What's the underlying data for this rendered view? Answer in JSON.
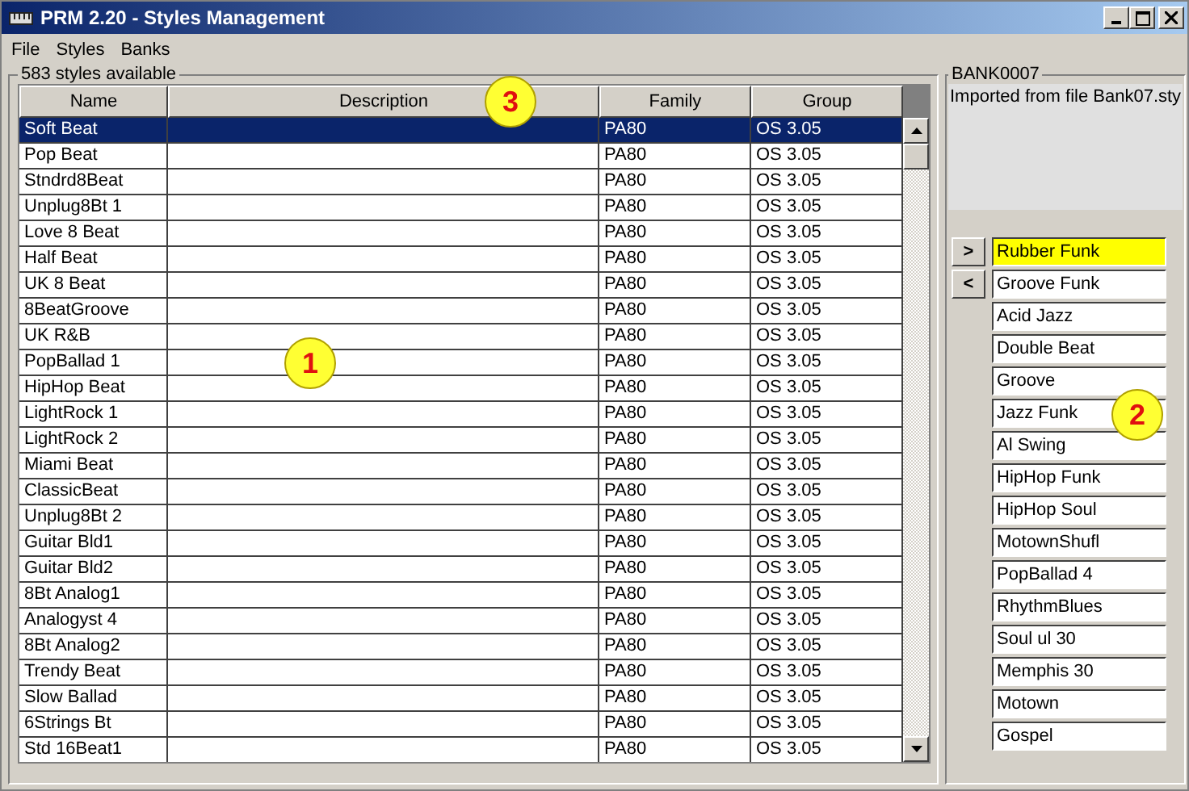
{
  "window": {
    "title": "PRM 2.20 - Styles Management"
  },
  "menu": [
    "File",
    "Styles",
    "Banks"
  ],
  "styles_panel": {
    "title": "583 styles available",
    "columns": [
      "Name",
      "Description",
      "Family",
      "Group"
    ],
    "rows": [
      {
        "name": "Soft Beat",
        "family": "PA80",
        "group": "OS 3.05",
        "selected": true
      },
      {
        "name": "Pop Beat",
        "family": "PA80",
        "group": "OS 3.05",
        "selected": false
      },
      {
        "name": "Stndrd8Beat",
        "family": "PA80",
        "group": "OS 3.05",
        "selected": false
      },
      {
        "name": "Unplug8Bt 1",
        "family": "PA80",
        "group": "OS 3.05",
        "selected": false
      },
      {
        "name": "Love 8 Beat",
        "family": "PA80",
        "group": "OS 3.05",
        "selected": false
      },
      {
        "name": "Half Beat",
        "family": "PA80",
        "group": "OS 3.05",
        "selected": false
      },
      {
        "name": "UK 8 Beat",
        "family": "PA80",
        "group": "OS 3.05",
        "selected": false
      },
      {
        "name": "8BeatGroove",
        "family": "PA80",
        "group": "OS 3.05",
        "selected": false
      },
      {
        "name": "UK R&B",
        "family": "PA80",
        "group": "OS 3.05",
        "selected": false
      },
      {
        "name": "PopBallad 1",
        "family": "PA80",
        "group": "OS 3.05",
        "selected": false
      },
      {
        "name": "HipHop Beat",
        "family": "PA80",
        "group": "OS 3.05",
        "selected": false
      },
      {
        "name": "LightRock 1",
        "family": "PA80",
        "group": "OS 3.05",
        "selected": false
      },
      {
        "name": "LightRock 2",
        "family": "PA80",
        "group": "OS 3.05",
        "selected": false
      },
      {
        "name": "Miami Beat",
        "family": "PA80",
        "group": "OS 3.05",
        "selected": false
      },
      {
        "name": "ClassicBeat",
        "family": "PA80",
        "group": "OS 3.05",
        "selected": false
      },
      {
        "name": "Unplug8Bt 2",
        "family": "PA80",
        "group": "OS 3.05",
        "selected": false
      },
      {
        "name": "Guitar Bld1",
        "family": "PA80",
        "group": "OS 3.05",
        "selected": false
      },
      {
        "name": "Guitar Bld2",
        "family": "PA80",
        "group": "OS 3.05",
        "selected": false
      },
      {
        "name": "8Bt Analog1",
        "family": "PA80",
        "group": "OS 3.05",
        "selected": false
      },
      {
        "name": "Analogyst 4",
        "family": "PA80",
        "group": "OS 3.05",
        "selected": false
      },
      {
        "name": "8Bt Analog2",
        "family": "PA80",
        "group": "OS 3.05",
        "selected": false
      },
      {
        "name": "Trendy Beat",
        "family": "PA80",
        "group": "OS 3.05",
        "selected": false
      },
      {
        "name": "Slow Ballad",
        "family": "PA80",
        "group": "OS 3.05",
        "selected": false
      },
      {
        "name": "6Strings Bt",
        "family": "PA80",
        "group": "OS 3.05",
        "selected": false
      },
      {
        "name": "Std 16Beat1",
        "family": "PA80",
        "group": "OS 3.05",
        "selected": false
      }
    ]
  },
  "bank_panel": {
    "title": "BANK0007",
    "description": "Imported from file Bank07.sty",
    "buttons": [
      ">",
      "<"
    ],
    "items": [
      {
        "name": "Rubber Funk",
        "selected": true
      },
      {
        "name": "Groove Funk",
        "selected": false
      },
      {
        "name": "Acid Jazz",
        "selected": false
      },
      {
        "name": "Double Beat",
        "selected": false
      },
      {
        "name": "Groove",
        "selected": false
      },
      {
        "name": "Jazz Funk",
        "selected": false
      },
      {
        "name": "Al Swing",
        "selected": false
      },
      {
        "name": "HipHop Funk",
        "selected": false
      },
      {
        "name": "HipHop Soul",
        "selected": false
      },
      {
        "name": "MotownShufl",
        "selected": false
      },
      {
        "name": "PopBallad 4",
        "selected": false
      },
      {
        "name": "RhythmBlues",
        "selected": false
      },
      {
        "name": "Soul ul 30",
        "selected": false
      },
      {
        "name": "Memphis 30",
        "selected": false
      },
      {
        "name": "Motown",
        "selected": false
      },
      {
        "name": "Gospel",
        "selected": false
      }
    ]
  },
  "callouts": [
    {
      "label": "3",
      "kind": "header"
    },
    {
      "label": "1",
      "kind": "table"
    },
    {
      "label": "2",
      "kind": "bank"
    }
  ]
}
